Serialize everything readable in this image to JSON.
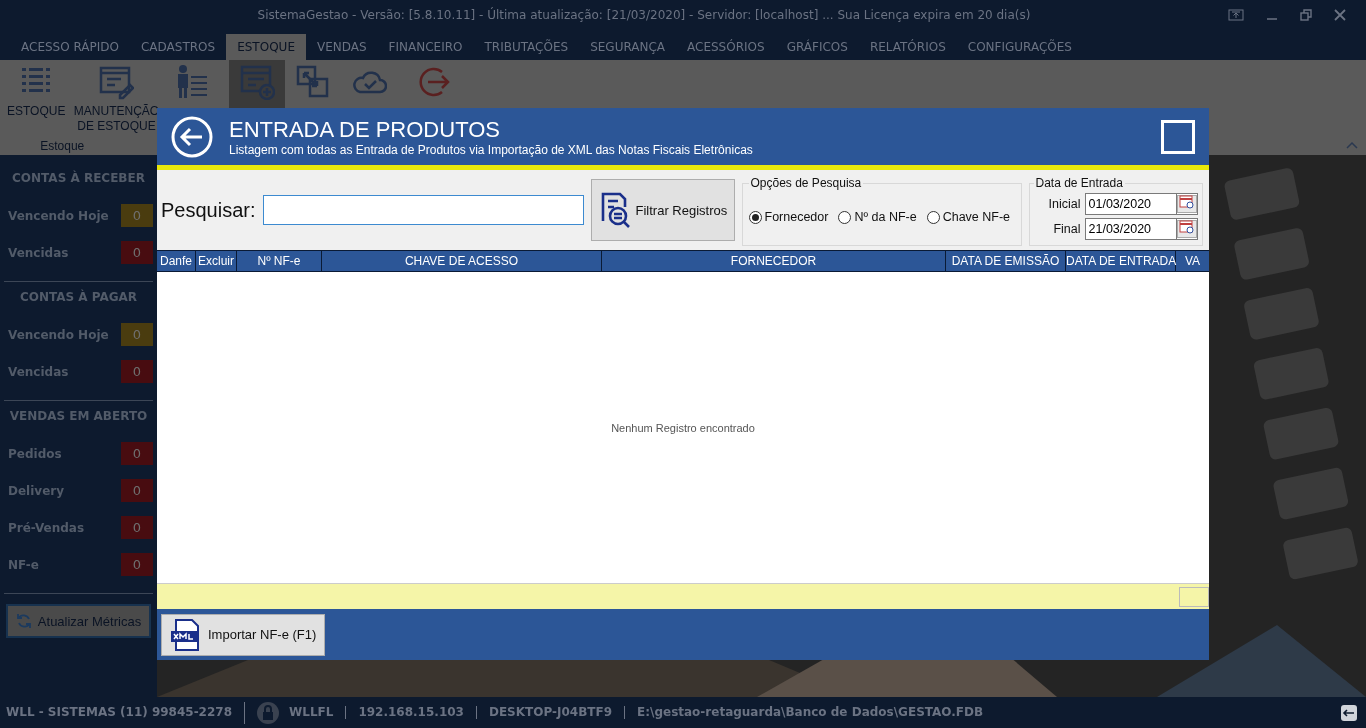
{
  "window": {
    "title": "SistemaGestao - Versão: [5.8.10.11] - Última atualização: [21/03/2020] - Servidor: [localhost] ... Sua Licença expira em 20 dia(s)"
  },
  "tabs": [
    {
      "label": "ACESSO RÁPIDO",
      "selected": false
    },
    {
      "label": "CADASTROS",
      "selected": false
    },
    {
      "label": "ESTOQUE",
      "selected": true
    },
    {
      "label": "VENDAS",
      "selected": false
    },
    {
      "label": "FINANCEIRO",
      "selected": false
    },
    {
      "label": "TRIBUTAÇÕES",
      "selected": false
    },
    {
      "label": "SEGURANÇA",
      "selected": false
    },
    {
      "label": "ACESSÓRIOS",
      "selected": false
    },
    {
      "label": "GRÁFICOS",
      "selected": false
    },
    {
      "label": "RELATÓRIOS",
      "selected": false
    },
    {
      "label": "CONFIGURAÇÕES",
      "selected": false
    }
  ],
  "ribbon": {
    "groups": [
      {
        "label": "Estoque",
        "items": [
          {
            "kind": "list",
            "label": "ESTOQUE",
            "selected": false
          },
          {
            "kind": "form",
            "label": "MANUTENÇÃO DE ESTOQUE",
            "selected": false
          },
          {
            "kind": "person",
            "selected": false
          }
        ]
      },
      {
        "items": [
          {
            "kind": "docplus",
            "selected": true
          },
          {
            "kind": "convert",
            "selected": false
          },
          {
            "kind": "cloud",
            "selected": false
          }
        ]
      },
      {
        "items": [
          {
            "kind": "exit",
            "selected": false
          }
        ]
      }
    ]
  },
  "sidebar": {
    "sections": [
      {
        "title": "CONTAS À RECEBER",
        "metrics": [
          {
            "label": "Vencendo Hoje",
            "value": "0",
            "color": "#4a3c0f"
          },
          {
            "label": "Vencidas",
            "value": "0",
            "color": "#480c10"
          }
        ]
      },
      {
        "title": "CONTAS À PAGAR",
        "metrics": [
          {
            "label": "Vencendo Hoje",
            "value": "0",
            "color": "#4a3c0f"
          },
          {
            "label": "Vencidas",
            "value": "0",
            "color": "#480c10"
          }
        ]
      },
      {
        "title": "VENDAS EM ABERTO",
        "metrics": [
          {
            "label": "Pedidos",
            "value": "0",
            "color": "#480c10"
          },
          {
            "label": "Delivery",
            "value": "0",
            "color": "#480c10"
          },
          {
            "label": "Pré-Vendas",
            "value": "0",
            "color": "#480c10"
          },
          {
            "label": "NF-e",
            "value": "0",
            "color": "#480c10"
          }
        ]
      }
    ],
    "button": "Atualizar Métricas"
  },
  "dialog": {
    "title": "ENTRADA DE PRODUTOS",
    "subtitle": "Listagem com todas as Entrada de Produtos via Importação de XML das Notas Fiscais Eletrônicas",
    "search": {
      "label": "Pesquisar:"
    },
    "filter_button": "Filtrar Registros",
    "search_options": {
      "title": "Opções de Pesquisa",
      "options": [
        {
          "label": "Fornecedor",
          "selected": true
        },
        {
          "label": "Nº da NF-e",
          "selected": false
        },
        {
          "label": "Chave NF-e",
          "selected": false
        }
      ]
    },
    "date_range": {
      "title": "Data de Entrada",
      "fields": [
        {
          "label": "Inicial",
          "value": "01/03/2020"
        },
        {
          "label": "Final",
          "value": "21/03/2020"
        }
      ]
    },
    "table": {
      "columns": [
        "Danfe",
        "Excluir",
        "Nº NF-e",
        "CHAVE DE ACESSO",
        "FORNECEDOR",
        "DATA DE EMISSÃO",
        "DATA DE ENTRADA",
        "VA"
      ],
      "empty_message": "Nenhum Registro encontrado"
    },
    "import_button": "Importar NF-e (F1)"
  },
  "status_bar": [
    {
      "kind": "text",
      "text": "WLL - SISTEMAS (11) 99845-2278"
    },
    {
      "kind": "lock",
      "text": "WLLFL"
    },
    {
      "kind": "text",
      "text": "192.168.15.103"
    },
    {
      "kind": "text",
      "text": "DESKTOP-J04BTF9"
    },
    {
      "kind": "text",
      "text": "E:\\gestao-retaguarda\\Banco de Dados\\GESTAO.FDB"
    }
  ]
}
